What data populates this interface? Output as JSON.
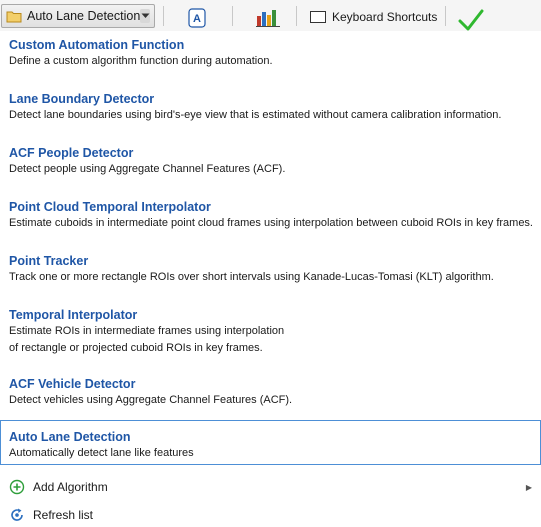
{
  "toolbar": {
    "dropdown_label": "Auto Lane Detection",
    "keyboard_label": "Keyboard Shortcuts"
  },
  "menu": {
    "items": [
      {
        "title": "Custom Automation Function",
        "desc": [
          "Define a custom algorithm function during automation."
        ]
      },
      {
        "title": "Lane Boundary Detector",
        "desc": [
          "Detect lane boundaries using bird's-eye view that is estimated without camera calibration information."
        ]
      },
      {
        "title": "ACF People Detector",
        "desc": [
          "Detect people using Aggregate Channel Features (ACF)."
        ]
      },
      {
        "title": "Point Cloud Temporal Interpolator",
        "desc": [
          "Estimate cuboids in intermediate point cloud frames using interpolation between cuboid ROIs in key frames."
        ]
      },
      {
        "title": "Point Tracker",
        "desc": [
          "Track one or more rectangle ROIs over short intervals using Kanade-Lucas-Tomasi (KLT) algorithm."
        ]
      },
      {
        "title": "Temporal Interpolator",
        "desc": [
          "Estimate ROIs in intermediate frames using interpolation",
          "of rectangle or projected cuboid ROIs in key frames."
        ]
      },
      {
        "title": "ACF Vehicle Detector",
        "desc": [
          "Detect vehicles using Aggregate Channel Features (ACF)."
        ]
      },
      {
        "title": "Auto Lane Detection",
        "desc": [
          "Automatically detect lane like features"
        ],
        "selected": true
      }
    ],
    "add_algorithm_label": "Add Algorithm",
    "refresh_label": "Refresh list"
  },
  "colors": {
    "title_blue": "#1f56a6",
    "selection_border": "#4d8fd6",
    "add_icon_green": "#2e9e3a",
    "check_green": "#2fb82f"
  },
  "icons": {
    "dropdown": "folder-icon",
    "add": "plus-circle-icon",
    "refresh": "refresh-icon"
  }
}
